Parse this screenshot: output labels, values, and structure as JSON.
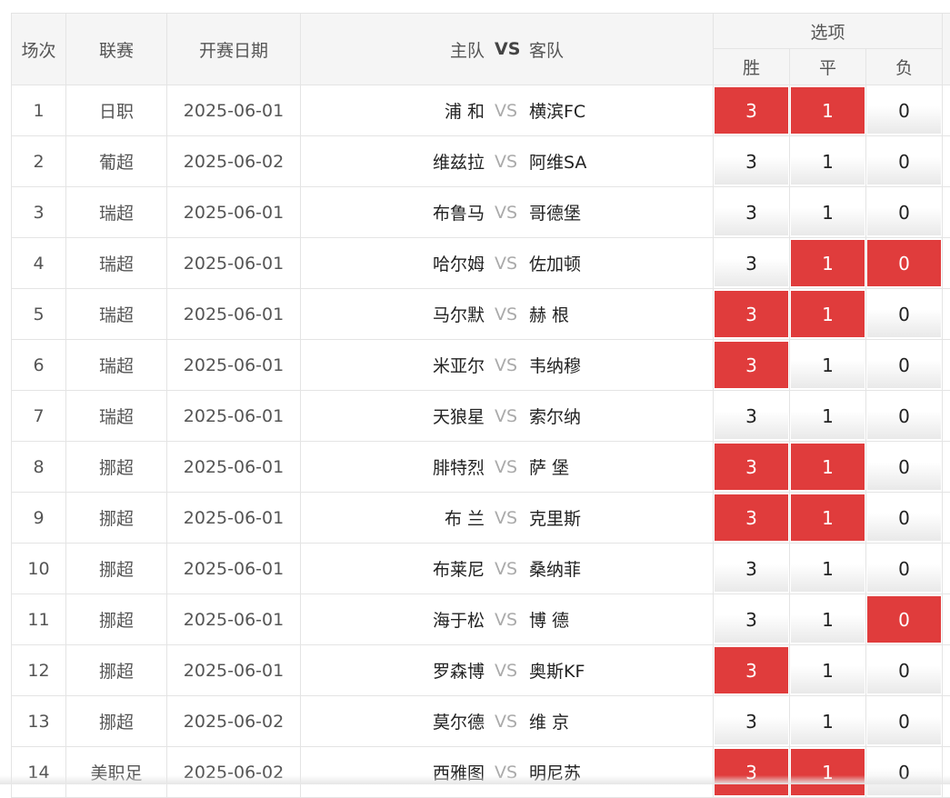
{
  "header": {
    "index": "场次",
    "league": "联赛",
    "date": "开赛日期",
    "home": "主队",
    "vs": "VS",
    "away": "客队",
    "options": "选项",
    "win": "胜",
    "draw": "平",
    "lose": "负"
  },
  "colors": {
    "selected": "#e03c3c",
    "header_bg": "#f5f5f5"
  },
  "matches": [
    {
      "no": "1",
      "league": "日职",
      "date": "2025-06-01",
      "home": "浦 和",
      "vs": "VS",
      "away": "横滨FC",
      "w": "3",
      "d": "1",
      "l": "0",
      "sel": {
        "w": true,
        "d": true,
        "l": false
      }
    },
    {
      "no": "2",
      "league": "葡超",
      "date": "2025-06-02",
      "home": "维兹拉",
      "vs": "VS",
      "away": "阿维SA",
      "w": "3",
      "d": "1",
      "l": "0",
      "sel": {
        "w": false,
        "d": false,
        "l": false
      }
    },
    {
      "no": "3",
      "league": "瑞超",
      "date": "2025-06-01",
      "home": "布鲁马",
      "vs": "VS",
      "away": "哥德堡",
      "w": "3",
      "d": "1",
      "l": "0",
      "sel": {
        "w": false,
        "d": false,
        "l": false
      }
    },
    {
      "no": "4",
      "league": "瑞超",
      "date": "2025-06-01",
      "home": "哈尔姆",
      "vs": "VS",
      "away": "佐加顿",
      "w": "3",
      "d": "1",
      "l": "0",
      "sel": {
        "w": false,
        "d": true,
        "l": true
      }
    },
    {
      "no": "5",
      "league": "瑞超",
      "date": "2025-06-01",
      "home": "马尔默",
      "vs": "VS",
      "away": "赫 根",
      "w": "3",
      "d": "1",
      "l": "0",
      "sel": {
        "w": true,
        "d": true,
        "l": false
      }
    },
    {
      "no": "6",
      "league": "瑞超",
      "date": "2025-06-01",
      "home": "米亚尔",
      "vs": "VS",
      "away": "韦纳穆",
      "w": "3",
      "d": "1",
      "l": "0",
      "sel": {
        "w": true,
        "d": false,
        "l": false
      }
    },
    {
      "no": "7",
      "league": "瑞超",
      "date": "2025-06-01",
      "home": "天狼星",
      "vs": "VS",
      "away": "索尔纳",
      "w": "3",
      "d": "1",
      "l": "0",
      "sel": {
        "w": false,
        "d": false,
        "l": false
      }
    },
    {
      "no": "8",
      "league": "挪超",
      "date": "2025-06-01",
      "home": "腓特烈",
      "vs": "VS",
      "away": "萨 堡",
      "w": "3",
      "d": "1",
      "l": "0",
      "sel": {
        "w": true,
        "d": true,
        "l": false
      }
    },
    {
      "no": "9",
      "league": "挪超",
      "date": "2025-06-01",
      "home": "布 兰",
      "vs": "VS",
      "away": "克里斯",
      "w": "3",
      "d": "1",
      "l": "0",
      "sel": {
        "w": true,
        "d": true,
        "l": false
      }
    },
    {
      "no": "10",
      "league": "挪超",
      "date": "2025-06-01",
      "home": "布莱尼",
      "vs": "VS",
      "away": "桑纳菲",
      "w": "3",
      "d": "1",
      "l": "0",
      "sel": {
        "w": false,
        "d": false,
        "l": false
      }
    },
    {
      "no": "11",
      "league": "挪超",
      "date": "2025-06-01",
      "home": "海于松",
      "vs": "VS",
      "away": "博 德",
      "w": "3",
      "d": "1",
      "l": "0",
      "sel": {
        "w": false,
        "d": false,
        "l": true
      }
    },
    {
      "no": "12",
      "league": "挪超",
      "date": "2025-06-01",
      "home": "罗森博",
      "vs": "VS",
      "away": "奥斯KF",
      "w": "3",
      "d": "1",
      "l": "0",
      "sel": {
        "w": true,
        "d": false,
        "l": false
      }
    },
    {
      "no": "13",
      "league": "挪超",
      "date": "2025-06-02",
      "home": "莫尔德",
      "vs": "VS",
      "away": "维 京",
      "w": "3",
      "d": "1",
      "l": "0",
      "sel": {
        "w": false,
        "d": false,
        "l": false
      }
    },
    {
      "no": "14",
      "league": "美职足",
      "date": "2025-06-02",
      "home": "西雅图",
      "vs": "VS",
      "away": "明尼苏",
      "w": "3",
      "d": "1",
      "l": "0",
      "sel": {
        "w": true,
        "d": true,
        "l": false
      }
    }
  ]
}
